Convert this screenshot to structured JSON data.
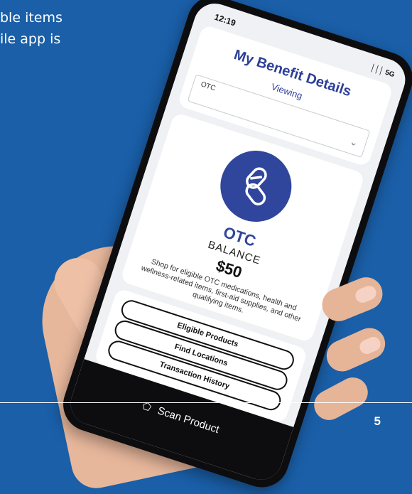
{
  "intro": {
    "line1": "ble items",
    "line2": "ile app is"
  },
  "phone": {
    "status_time": "12:19",
    "status_signal": "│││ 5G",
    "header": {
      "title": "My Benefit Details",
      "viewing_label": "Viewing",
      "select_value": "OTC",
      "chevron": "⌄"
    },
    "benefit": {
      "icon": "pill-icon",
      "name": "OTC",
      "balance_label": "BALANCE",
      "balance_amount": "$50",
      "description": "Shop for eligible OTC medications, health and wellness-related items, first-aid supplies, and other qualifying items."
    },
    "actions": [
      {
        "label": "Eligible Products"
      },
      {
        "label": "Find Locations"
      },
      {
        "label": "Transaction History"
      }
    ],
    "bottom_bar": {
      "scan_label": "Scan Product",
      "scan_icon": "tag-icon"
    }
  },
  "page_number": "5",
  "colors": {
    "background": "#1a5fa8",
    "accent": "#30469c",
    "phone_body": "#0d0d0f"
  }
}
